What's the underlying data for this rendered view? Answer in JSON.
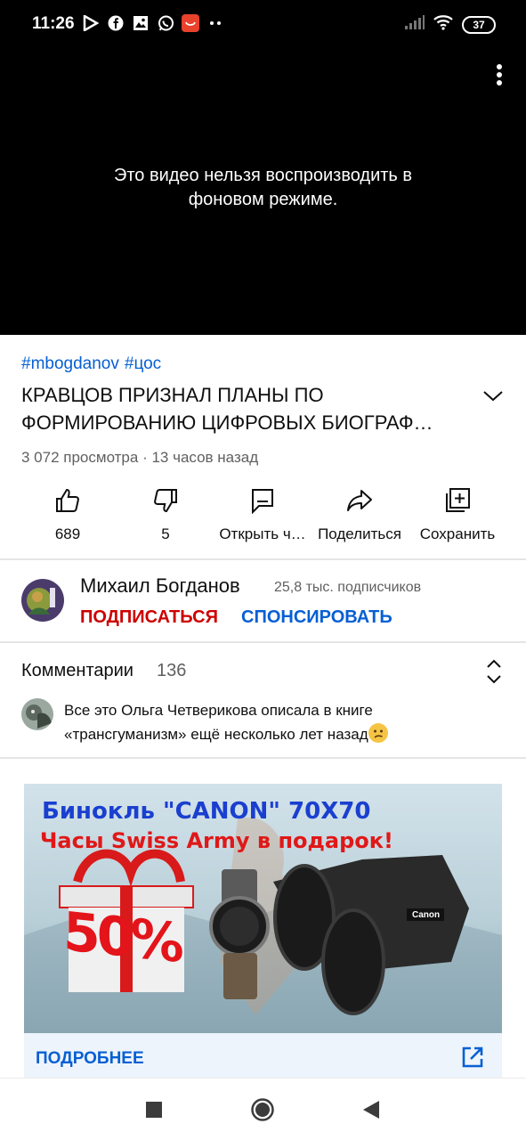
{
  "status_bar": {
    "time": "11:26",
    "battery": "37",
    "icons": [
      "play-store-icon",
      "facebook-icon",
      "image-icon",
      "whatsapp-icon",
      "aliexpress-icon",
      "more-dots-icon"
    ]
  },
  "video": {
    "message": "Это видео нельзя воспроизводить в фоновом режиме."
  },
  "hashtags": [
    "#mbogdanov",
    "#цос"
  ],
  "title": "КРАВЦОВ ПРИЗНАЛ ПЛАНЫ ПО ФОРМИРОВАНИЮ ЦИФРОВЫХ БИОГРАФ…",
  "meta": "3 072 просмотра · 13 часов назад",
  "actions": [
    {
      "label": "689",
      "icon": "thumb-up-icon"
    },
    {
      "label": "5",
      "icon": "thumb-down-icon"
    },
    {
      "label": "Открыть ч…",
      "icon": "chat-icon"
    },
    {
      "label": "Поделиться",
      "icon": "share-icon"
    },
    {
      "label": "Сохранить",
      "icon": "add-to-playlist-icon"
    }
  ],
  "channel": {
    "name": "Михаил Богданов",
    "subscribers": "25,8 тыс. подписчиков",
    "subscribe_label": "ПОДПИСАТЬСЯ",
    "sponsor_label": "СПОНСИРОВАТЬ"
  },
  "comments": {
    "title": "Комментарии",
    "count": "136",
    "top_comment": "Все это Ольга Четверикова описала в книге «трансгуманизм» ещё несколько лет назад"
  },
  "ad": {
    "headline1": "Бинокль \"CANON\" 70X70",
    "headline2": "Часы Swiss Army в подарок!",
    "discount": "50%",
    "brand": "Canon",
    "cta": "ПОДРОБНЕЕ"
  },
  "colors": {
    "link_blue": "#065fd4",
    "subscribe_red": "#cc0000",
    "secondary_text": "#606060"
  }
}
